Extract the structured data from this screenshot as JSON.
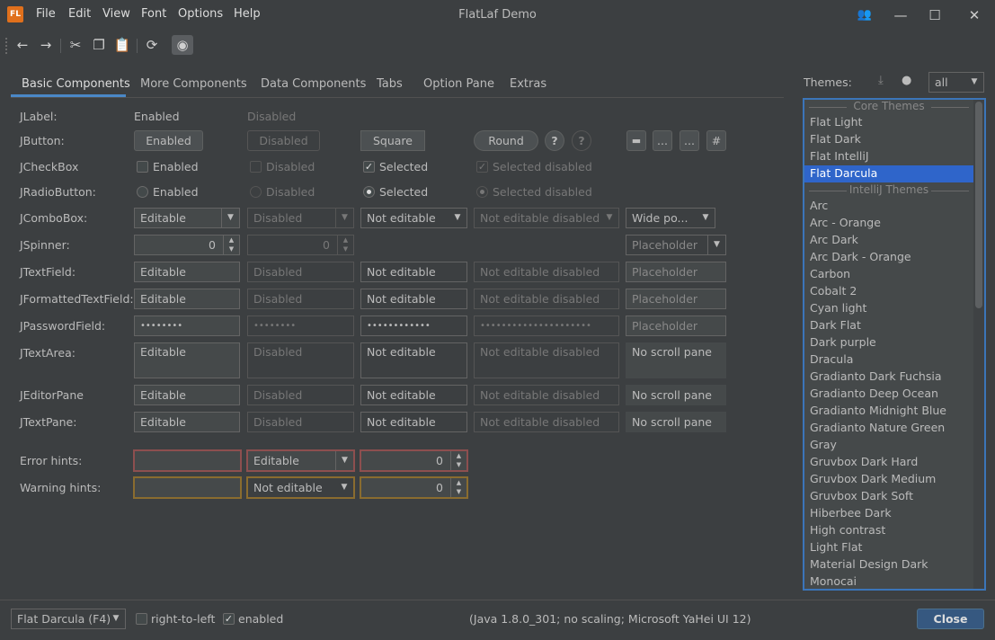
{
  "window": {
    "logo": "FL",
    "title": "FlatLaf Demo",
    "controls": [
      "people-icon",
      "minimize-icon",
      "maximize-icon",
      "close-icon"
    ]
  },
  "menu": [
    "File",
    "Edit",
    "View",
    "Font",
    "Options",
    "Help"
  ],
  "toolbar": [
    "back-icon",
    "forward-icon",
    "cut-icon",
    "copy-icon",
    "paste-icon",
    "refresh-icon",
    "eye-icon"
  ],
  "tabs": [
    "Basic Components",
    "More Components",
    "Data Components",
    "Tabs",
    "Option Pane",
    "Extras"
  ],
  "rows": {
    "jlabel": {
      "label": "JLabel:",
      "enabled": "Enabled",
      "disabled": "Disabled"
    },
    "jbutton": {
      "label": "JButton:",
      "enabled": "Enabled",
      "disabled": "Disabled",
      "square": "Square",
      "round": "Round",
      "help": "?",
      "b1": "...",
      "b2": "...",
      "b3": "#"
    },
    "jcheckbox": {
      "label": "JCheckBox",
      "enabled": "Enabled",
      "disabled": "Disabled",
      "selected": "Selected",
      "selected_disabled": "Selected disabled",
      "check": "✓"
    },
    "jradio": {
      "label": "JRadioButton:",
      "enabled": "Enabled",
      "disabled": "Disabled",
      "selected": "Selected",
      "selected_disabled": "Selected disabled"
    },
    "jcombo": {
      "label": "JComboBox:",
      "editable": "Editable",
      "disabled": "Disabled",
      "not_editable": "Not editable",
      "not_editable_disabled": "Not editable disabled",
      "wide": "Wide po..."
    },
    "jspinner": {
      "label": "JSpinner:",
      "v1": "0",
      "v2": "0",
      "placeholder": "Placeholder"
    },
    "jtextfield": {
      "label": "JTextField:",
      "editable": "Editable",
      "disabled": "Disabled",
      "not_editable": "Not editable",
      "not_editable_disabled": "Not editable disabled",
      "placeholder": "Placeholder"
    },
    "jformatted": {
      "label": "JFormattedTextField:",
      "editable": "Editable",
      "disabled": "Disabled",
      "not_editable": "Not editable",
      "not_editable_disabled": "Not editable disabled",
      "placeholder": "Placeholder"
    },
    "jpassword": {
      "label": "JPasswordField:",
      "editable": "••••••••",
      "disabled": "••••••••",
      "not_editable": "••••••••••••",
      "not_editable_disabled": "•••••••••••••••••••••",
      "placeholder": "Placeholder"
    },
    "jtextarea": {
      "label": "JTextArea:",
      "editable": "Editable",
      "disabled": "Disabled",
      "not_editable": "Not editable",
      "not_editable_disabled": "Not editable disabled",
      "noscroll": "No scroll pane"
    },
    "jeditor": {
      "label": "JEditorPane",
      "editable": "Editable",
      "disabled": "Disabled",
      "not_editable": "Not editable",
      "not_editable_disabled": "Not editable disabled",
      "noscroll": "No scroll pane"
    },
    "jtextpane": {
      "label": "JTextPane:",
      "editable": "Editable",
      "disabled": "Disabled",
      "not_editable": "Not editable",
      "not_editable_disabled": "Not editable disabled",
      "noscroll": "No scroll pane"
    },
    "error": {
      "label": "Error hints:",
      "combo": "Editable",
      "spin": "0"
    },
    "warning": {
      "label": "Warning hints:",
      "combo": "Not editable",
      "spin": "0"
    }
  },
  "themes": {
    "label": "Themes:",
    "filter": "all",
    "header_core": "Core Themes",
    "header_intellij": "IntelliJ Themes",
    "core": [
      "Flat Light",
      "Flat Dark",
      "Flat IntelliJ",
      "Flat Darcula"
    ],
    "selected": "Flat Darcula",
    "intellij": [
      "Arc",
      "Arc - Orange",
      "Arc Dark",
      "Arc Dark - Orange",
      "Carbon",
      "Cobalt 2",
      "Cyan light",
      "Dark Flat",
      "Dark purple",
      "Dracula",
      "Gradianto Dark Fuchsia",
      "Gradianto Deep Ocean",
      "Gradianto Midnight Blue",
      "Gradianto Nature Green",
      "Gray",
      "Gruvbox Dark Hard",
      "Gruvbox Dark Medium",
      "Gruvbox Dark Soft",
      "Hiberbee Dark",
      "High contrast",
      "Light Flat",
      "Material Design Dark",
      "Monocai"
    ]
  },
  "status": {
    "laf": "Flat Darcula (F4)",
    "rtl": "right-to-left",
    "enabled": "enabled",
    "enabled_check": "✓",
    "info": "(Java 1.8.0_301; no scaling; Microsoft YaHei UI 12)",
    "close": "Close"
  },
  "colors": {
    "accent": "#4a88c7",
    "selection": "#2f65ca",
    "background": "#3c3f41",
    "error": "#8d4f4f",
    "warning": "#8a6c2f"
  }
}
